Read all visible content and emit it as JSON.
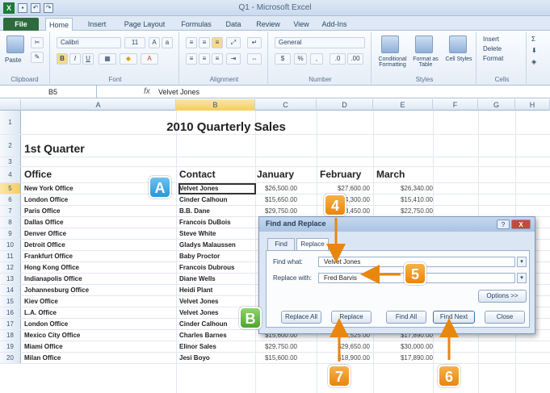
{
  "window": {
    "title": "Q1 - Microsoft Excel",
    "app_icon": "X"
  },
  "ribbon_tabs": [
    "File",
    "Home",
    "Insert",
    "Page Layout",
    "Formulas",
    "Data",
    "Review",
    "View",
    "Add-Ins"
  ],
  "ribbon": {
    "clipboard_label": "Clipboard",
    "paste_label": "Paste",
    "font_name": "Calibri",
    "font_size": "11",
    "font_label": "Font",
    "alignment_label": "Alignment",
    "number_format": "General",
    "number_label": "Number",
    "conditional_formatting": "Conditional Formatting",
    "format_as_table": "Format as Table",
    "cell_styles": "Cell Styles",
    "styles_label": "Styles",
    "insert": "Insert",
    "delete": "Delete",
    "format": "Format",
    "cells_label": "Cells"
  },
  "formula_bar": {
    "name_box": "B5",
    "fx": "fx",
    "value": "Velvet Jones"
  },
  "columns": [
    "A",
    "B",
    "C",
    "D",
    "E",
    "F",
    "G",
    "H"
  ],
  "sheet": {
    "title": "2010 Quarterly Sales",
    "quarter": "1st Quarter",
    "headers": {
      "office": "Office",
      "contact": "Contact",
      "jan": "January",
      "feb": "February",
      "mar": "March"
    },
    "rows": [
      {
        "num": "5",
        "office": "New York Office",
        "contact": "Velvet Jones",
        "jan": "$26,500.00",
        "feb": "$27,600.00",
        "mar": "$26,340.00"
      },
      {
        "num": "6",
        "office": "London Office",
        "contact": "Cinder Calhoun",
        "jan": "$15,650.00",
        "feb": "$14,300.00",
        "mar": "$15,410.00"
      },
      {
        "num": "7",
        "office": "Paris Office",
        "contact": "B.B. Dane",
        "jan": "$29,750.00",
        "feb": "$28,450.00",
        "mar": "$22,750.00"
      },
      {
        "num": "8",
        "office": "Dallas Office",
        "contact": "Francois DuBois",
        "jan": "",
        "feb": "",
        "mar": ""
      },
      {
        "num": "9",
        "office": "Denver Office",
        "contact": "Steve White",
        "jan": "",
        "feb": "",
        "mar": ""
      },
      {
        "num": "10",
        "office": "Detroit Office",
        "contact": "Gladys Malaussen",
        "jan": "",
        "feb": "",
        "mar": ""
      },
      {
        "num": "11",
        "office": "Frankfurt Office",
        "contact": "Baby Proctor",
        "jan": "",
        "feb": "",
        "mar": ""
      },
      {
        "num": "12",
        "office": "Hong Kong Office",
        "contact": "Francois Dubrous",
        "jan": "",
        "feb": "",
        "mar": ""
      },
      {
        "num": "13",
        "office": "Indianapolis Office",
        "contact": "Diane Wells",
        "jan": "",
        "feb": "",
        "mar": ""
      },
      {
        "num": "14",
        "office": "Johannesburg Office",
        "contact": "Heidi Plant",
        "jan": "",
        "feb": "",
        "mar": ""
      },
      {
        "num": "15",
        "office": "Kiev Office",
        "contact": "Velvet Jones",
        "jan": "",
        "feb": "",
        "mar": ""
      },
      {
        "num": "16",
        "office": "L.A. Office",
        "contact": "Velvet Jones",
        "jan": "",
        "feb": "",
        "mar": ""
      },
      {
        "num": "17",
        "office": "London Office",
        "contact": "Cinder Calhoun",
        "jan": "",
        "feb": "",
        "mar": ""
      },
      {
        "num": "18",
        "office": "Mexico City Office",
        "contact": "Charles Barnes",
        "jan": "$15,600.00",
        "feb": "$18,525.00",
        "mar": "$17,890.00"
      },
      {
        "num": "19",
        "office": "Miami Office",
        "contact": "Elinor Sales",
        "jan": "$29,750.00",
        "feb": "$29,650.00",
        "mar": "$30,000.00"
      },
      {
        "num": "20",
        "office": "Milan Office",
        "contact": "Jesi Boyo",
        "jan": "$15,600.00",
        "feb": "$18,900.00",
        "mar": "$17,890.00"
      }
    ]
  },
  "dialog": {
    "title": "Find and Replace",
    "help": "?",
    "close": "X",
    "tab_find": "Find",
    "tab_replace": "Replace",
    "find_label": "Find what:",
    "find_value": "Velvet Jones",
    "replace_label": "Replace with:",
    "replace_value": "Fred Barvis",
    "options": "Options >>",
    "replace_all": "Replace All",
    "replace": "Replace",
    "find_all": "Find All",
    "find_next": "Find Next",
    "close_btn": "Close"
  },
  "callouts": {
    "a": "A",
    "b": "B",
    "four": "4",
    "five": "5",
    "six": "6",
    "seven": "7"
  },
  "colors": {
    "callout_orange": "#e8860e",
    "callout_blue": "#2a95d6",
    "callout_green": "#4ea52f",
    "excel_green": "#1f7a3a"
  }
}
